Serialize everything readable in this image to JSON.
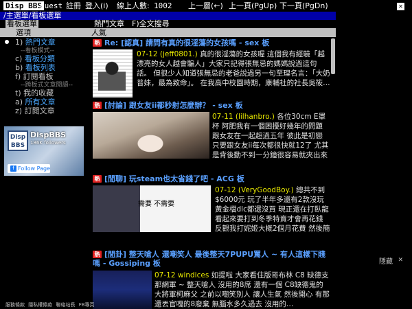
{
  "topbar": {
    "logo": "Disp BBS",
    "guest": "guest",
    "register": "註冊",
    "login": "登入(i)",
    "online_label": "線上人數:",
    "online_count": "1002",
    "home": "上一層(←)",
    "pgup": "上一頁(PgUp)",
    "pgdn": "下一頁(PgDn)",
    "close_icon": "close-icon"
  },
  "breadcrumb": "/主選單/看板選單",
  "tabs": {
    "active": "看板選單",
    "hot": "熱門文章",
    "search": "F)全文搜尋"
  },
  "header": {
    "select": "選項",
    "popularity": "人氣"
  },
  "menu": {
    "items": [
      {
        "key": "1)",
        "label": "熱門文章"
      },
      {
        "key": "c)",
        "label": "看板分類"
      },
      {
        "key": "b)",
        "label": "看板列表"
      },
      {
        "key": "f)",
        "label": "訂閱看板"
      },
      {
        "key": "t)",
        "label": "我的收藏"
      },
      {
        "key": "a)",
        "label": "所有文章"
      },
      {
        "key": "z)",
        "label": "訂閱文章"
      }
    ],
    "sep1": "--看板模式--",
    "sep2": "--跨板式文章閱讀--"
  },
  "fb": {
    "logo_line1": "Disp",
    "logo_line2": "BBS",
    "name": "DispBBS",
    "followers": "186K followers",
    "follow": "Follow Page"
  },
  "posts": [
    {
      "badge": "熱",
      "title": "Re: [認真] 請問有真的很淫蕩的女孩嗎 - sex 板",
      "date": "07-12",
      "author": "(jeff0801.)",
      "body": "真的很淫蕩的女孩喔  這個我有經驗「越漂亮的女人越會騙人」大家只記得張無忌的媽媽說過這句話。  但很少人知道張無忌的老爸說過另一句至理名言：「大奶普妹，最為致命」。  在我高中校園時期，康輔社的社長吳筱…"
    },
    {
      "badge": "熱",
      "title": "[討論] 跟女友ii都秒射怎麼辦？ - sex 板",
      "date": "07-11",
      "author": "(lilhanbro.)",
      "body": "各位30cm E罩杯 阿肥我有一個困擾好幾年的問題 跟女友在一起超過五年 彼此是初戀 只要跟女友ii每次都很快就12了 尤其是背後動不到一分鐘很容易就夾出來 雖然CD很快 第二次會好很多 雖然女…"
    },
    {
      "badge": "熱",
      "title": "[閒聊] 玩steam也太省錢了吧 - ACG 板",
      "date": "07-12",
      "author": "(VeryGoodBoy.)",
      "body": "總共不到$6000元 玩了半年多還有2款沒玩 黃金檔dlc都還沒買 現正還在打臥龍 看起來要打到冬季特賣才會再花錢 反觀我打妮姬大概2個月花費 然後簡單10秒就沒了 抽不到就抽到還不一定 妮姬已經買很…"
    },
    {
      "badge": "熱",
      "title": "[閒卦] 整天嗆人 還嘲笑人 最後整天7PUPU罵人 ~ 有人這樣下賤嗎 - Gossiping 板",
      "date": "07-12",
      "author": "windices",
      "body": "如提啦 大家看住版哥布林 C8 缺德支那網軍 ~ 整天嗆人 沒用的8席 還有一個 C8缺德鬼的大將軍柯麻父 之前以嘲笑別人 讓人生氣 然後開心 有那還丟官嘎的8廢棄 無腦水多久過去 沒用的…"
    }
  ],
  "ad": {
    "hide": "隱藏",
    "close": "✕"
  },
  "footer": [
    "服務條款",
    "隱私權條款",
    "聯絡站長",
    "FB專頁"
  ]
}
